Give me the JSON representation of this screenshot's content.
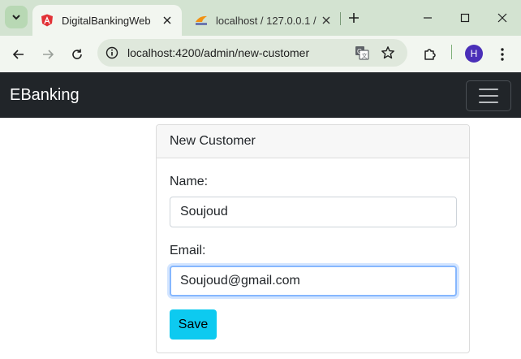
{
  "browser": {
    "tabs": [
      {
        "title": "DigitalBankingWeb",
        "icon": "angular-logo-icon",
        "active": true
      },
      {
        "title": "localhost / 127.0.0.1 / ",
        "icon": "phpmyadmin-logo-icon",
        "active": false
      }
    ],
    "address": "localhost:4200/admin/new-customer",
    "profile_initial": "H",
    "colors": {
      "tabstrip": "#d3e3d1",
      "toolbar": "#f2f6f0",
      "profile": "#4a2fb8"
    }
  },
  "navbar": {
    "brand": "EBanking",
    "background": "#212529"
  },
  "card": {
    "header": "New Customer",
    "fields": {
      "name": {
        "label": "Name:",
        "value": "Soujoud"
      },
      "email": {
        "label": "Email:",
        "value": "Soujoud@gmail.com"
      }
    },
    "save_label": "Save",
    "save_color": "#0dcaf0"
  }
}
